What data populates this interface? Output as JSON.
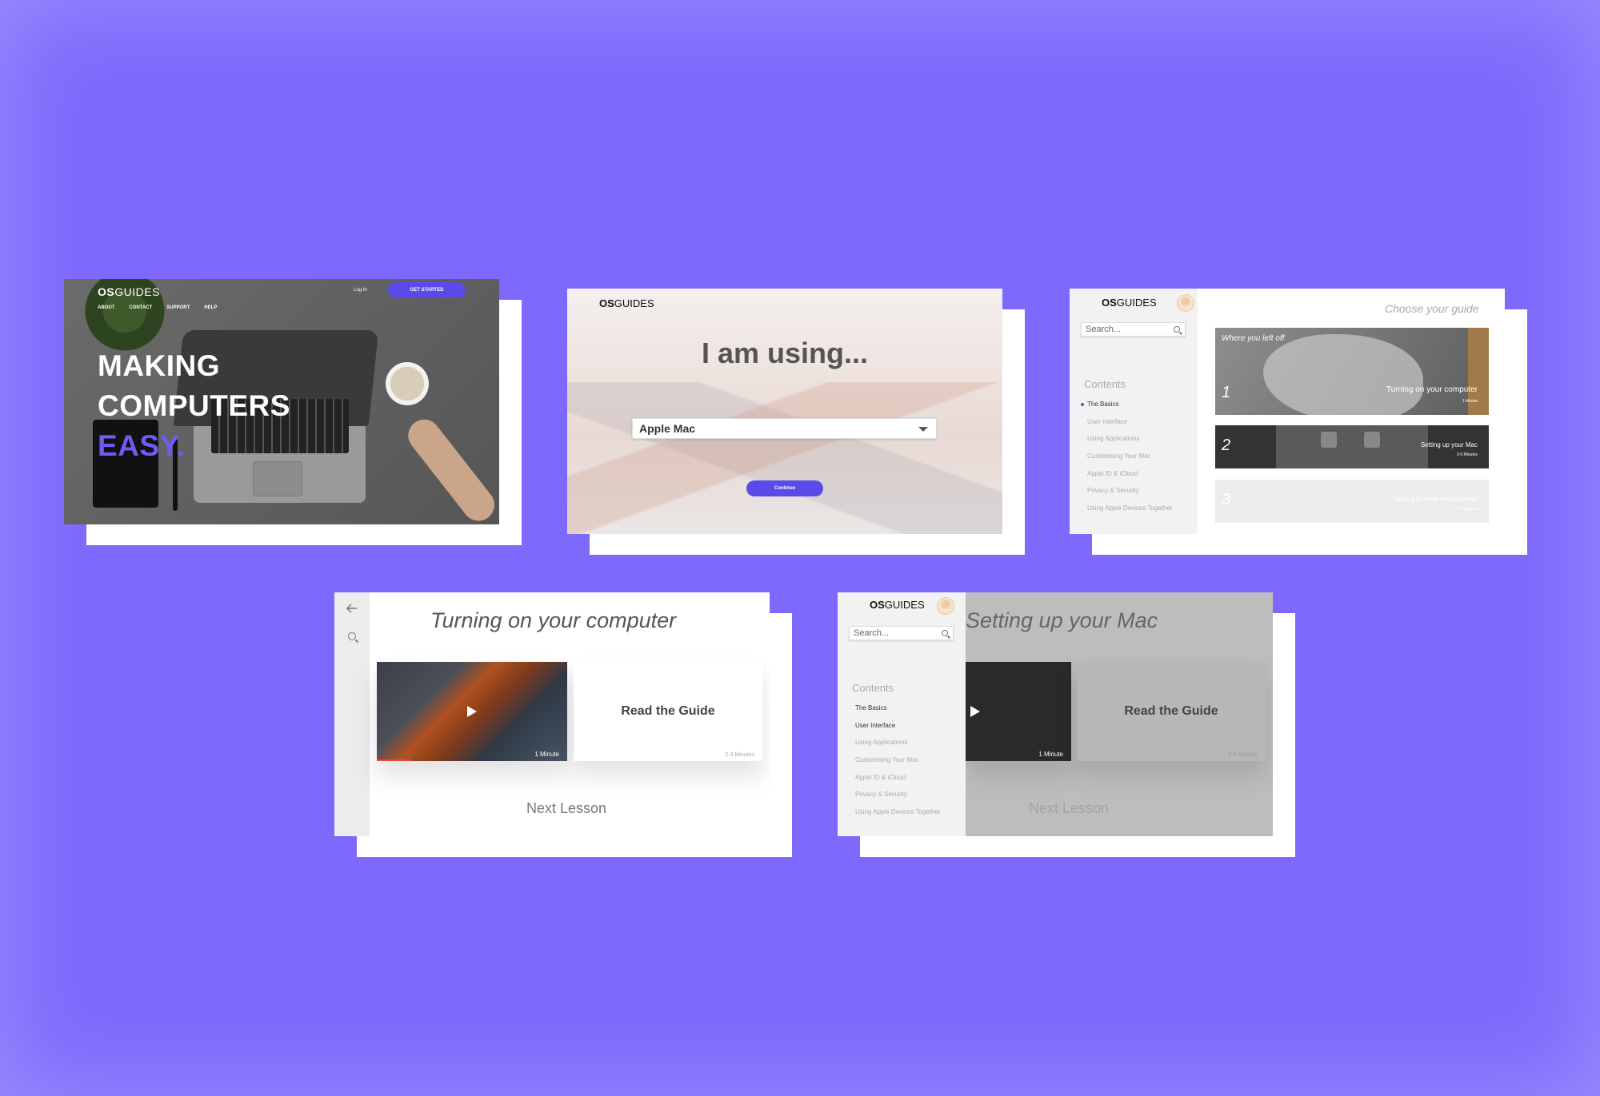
{
  "brand": {
    "bold": "OS",
    "light": "GUIDES"
  },
  "landing": {
    "nav": [
      "ABOUT",
      "CONTACT",
      "SUPPORT",
      "HELP"
    ],
    "login": "Log In",
    "cta": "GET STARTED",
    "hero": [
      "MAKING",
      "COMPUTERS",
      "EASY."
    ]
  },
  "chooser": {
    "title": "I am using...",
    "selected": "Apple Mac",
    "continue": "Continue"
  },
  "sidebar": {
    "search_placeholder": "Search...",
    "contents_heading": "Contents",
    "items": [
      "The Basics",
      "User Interface",
      "Using Applications",
      "Customising Your Mac",
      "Apple ID & iCloud",
      "Privacy & Security",
      "Using Apple Devices Together"
    ]
  },
  "guides_page": {
    "heading": "Choose your guide",
    "where_left_off": "Where you left off",
    "guides": [
      {
        "num": "1",
        "title": "Turning on your computer",
        "duration": "1 Minute"
      },
      {
        "num": "2",
        "title": "Setting up your Mac",
        "duration": "3-5 Minutes"
      },
      {
        "num": "3",
        "title": "Getting to know the hardware",
        "duration": "2-3 Minutes"
      }
    ]
  },
  "lesson1": {
    "title": "Turning on your computer",
    "video_duration": "1 Minute",
    "read_label": "Read the Guide",
    "read_duration": "2-3 Minutes",
    "next": "Next Lesson",
    "progress": 0.18
  },
  "lesson2": {
    "title": "Setting up your Mac",
    "video_duration": "1 Minute",
    "read_label": "Read the Guide",
    "read_duration": "2-3 Minutes",
    "next": "Next Lesson"
  },
  "colors": {
    "background": "#7d6afc",
    "accent": "#5a4be8"
  }
}
